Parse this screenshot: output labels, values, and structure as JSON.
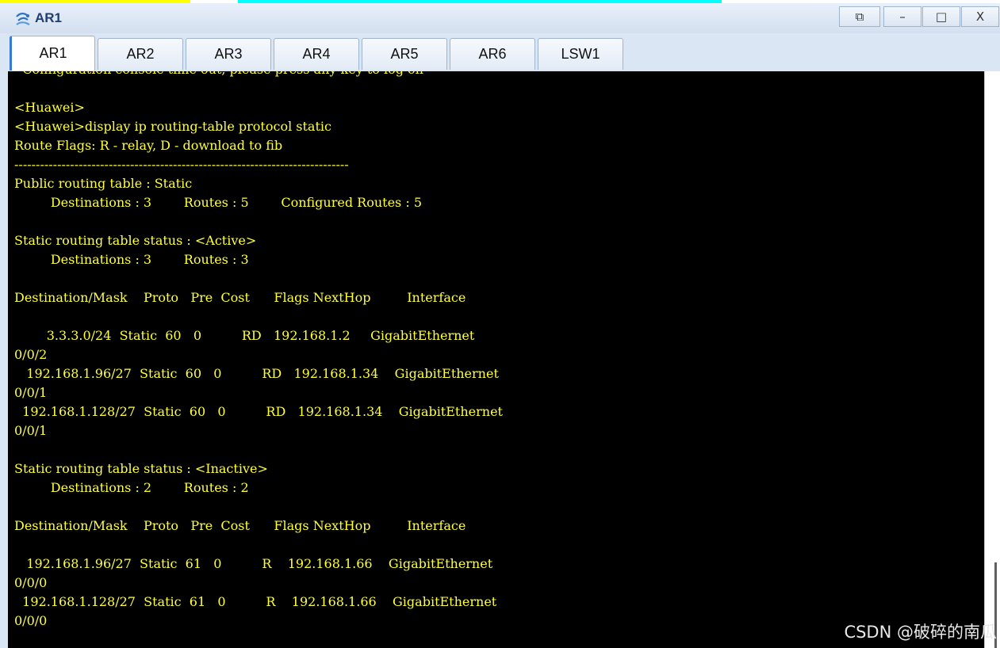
{
  "window": {
    "title": "AR1",
    "icon": "device-router-icon",
    "controls": {
      "restore_app": "⧉",
      "minimize": "–",
      "maximize": "□",
      "close": "X"
    }
  },
  "tabs": [
    {
      "label": "AR1",
      "active": true
    },
    {
      "label": "AR2",
      "active": false
    },
    {
      "label": "AR3",
      "active": false
    },
    {
      "label": "AR4",
      "active": false
    },
    {
      "label": "AR5",
      "active": false
    },
    {
      "label": "AR6",
      "active": false
    },
    {
      "label": "LSW1",
      "active": false
    }
  ],
  "terminal": {
    "lines": [
      "  Configuration console time out, please press any key to log on",
      "",
      "<Huawei>",
      "<Huawei>display ip routing-table protocol static",
      "Route Flags: R - relay, D - download to fib",
      "------------------------------------------------------------------------------",
      "Public routing table : Static",
      "         Destinations : 3        Routes : 5        Configured Routes : 5",
      "",
      "Static routing table status : <Active>",
      "         Destinations : 3        Routes : 3",
      "",
      "Destination/Mask    Proto   Pre  Cost      Flags NextHop         Interface",
      "",
      "        3.3.3.0/24  Static  60   0          RD   192.168.1.2     GigabitEthernet",
      "0/0/2",
      "   192.168.1.96/27  Static  60   0          RD   192.168.1.34    GigabitEthernet",
      "0/0/1",
      "  192.168.1.128/27  Static  60   0          RD   192.168.1.34    GigabitEthernet",
      "0/0/1",
      "",
      "Static routing table status : <Inactive>",
      "         Destinations : 2        Routes : 2",
      "",
      "Destination/Mask    Proto   Pre  Cost      Flags NextHop         Interface",
      "",
      "   192.168.1.96/27  Static  61   0          R    192.168.1.66    GigabitEthernet",
      "0/0/0",
      "  192.168.1.128/27  Static  61   0          R    192.168.1.66    GigabitEthernet",
      "0/0/0"
    ]
  },
  "watermark": "CSDN @破碎的南瓜",
  "colors": {
    "terminal_bg": "#000000",
    "terminal_text": "#ffff40",
    "chrome_bg": "#dbe6f4"
  }
}
